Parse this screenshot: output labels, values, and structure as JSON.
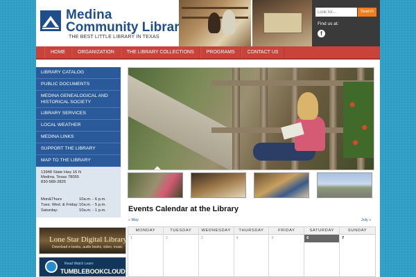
{
  "header": {
    "logo_line1": "Medina",
    "logo_line2": "Community Library",
    "tagline": "THE BEST LITTLE LIBRARY IN TEXAS",
    "search_placeholder": "Look for...",
    "search_button": "Search",
    "find_us": "Find us at:",
    "facebook_glyph": "f"
  },
  "nav": {
    "items": [
      "HOME",
      "ORGANIZATION",
      "THE LIBRARY COLLECTIONS",
      "PROGRAMS",
      "CONTACT US"
    ]
  },
  "sidebar": {
    "items": [
      "LIBRARY CATALOG",
      "PUBLIC DOCUMENTS",
      "MEDINA GENEALOGICAL AND HISTORICAL SOCIETY",
      "LIBRARY SERVICES",
      "LOCAL WEATHER",
      "MEDINA LINKS",
      "SUPPORT THE LIBRARY",
      "MAP TO THE LIBRARY"
    ],
    "address": [
      "13948 State Hwy 16 N",
      "Medina, Texas 78055",
      "830-589-2825"
    ],
    "hours": [
      {
        "days": "Mon&Thurs",
        "time": "10a.m. - 6 p.m."
      },
      {
        "days": "Tues. Wed. & Friday:",
        "time": "10a.m. - 5 p.m."
      },
      {
        "days": "Saturday:",
        "time": "10a.m. - 1 p.m."
      }
    ]
  },
  "banners": {
    "lonestar_title": "Lone Star Digital Library",
    "lonestar_sub": "Download e-books, audio books, video, music",
    "tumble_sub": "Read Watch Learn",
    "tumble_title": "TUMBLEBOOKCLOUD"
  },
  "calendar": {
    "title": "Events Calendar at the Library",
    "prev": "« May",
    "next": "July »",
    "days": [
      "MONDAY",
      "TUESDAY",
      "WEDNESDAY",
      "THURSDAY",
      "FRIDAY",
      "SATURDAY",
      "SUNDAY"
    ],
    "dates": [
      "1",
      "2",
      "3",
      "4",
      "5",
      "6",
      "7"
    ]
  },
  "colors": {
    "nav_red": "#c9433a",
    "sidebar_blue": "#2a5a9a",
    "search_orange": "#f07c1e",
    "background_teal": "#2f9ec4"
  }
}
